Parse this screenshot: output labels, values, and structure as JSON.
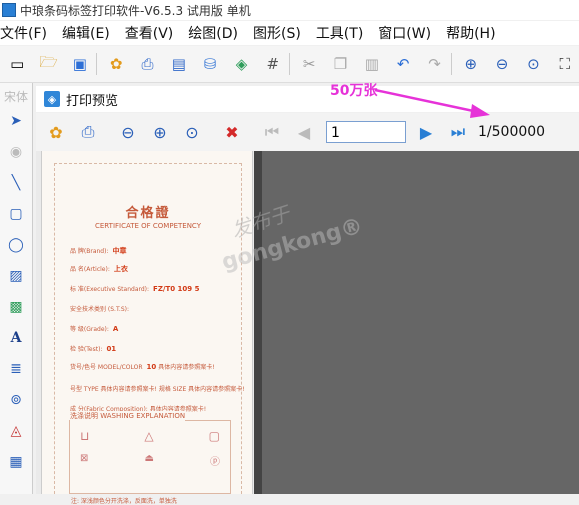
{
  "window": {
    "title": "中琅条码标签打印软件-V6.5.3 试用版 单机"
  },
  "menu": [
    "文件(F)",
    "编辑(E)",
    "查看(V)",
    "绘图(D)",
    "图形(S)",
    "工具(T)",
    "窗口(W)",
    "帮助(H)"
  ],
  "left_panel": {
    "font_label": "宋体"
  },
  "preview": {
    "title": "打印预览",
    "page_value": "1",
    "page_total": "1/500000"
  },
  "annotation": {
    "text": "50万张"
  },
  "label": {
    "title": "合格證",
    "subtitle": "CERTIFICATE OF COMPETENCY",
    "rows": [
      {
        "key": "品 牌(Brand):",
        "value": "中章"
      },
      {
        "key": "品 名(Article):",
        "value": "上衣"
      },
      {
        "key": "标 准(Executive Standard):",
        "value": "FZ/T0 109 5"
      },
      {
        "key": "安全技术类别 (S.T.S):",
        "value": ""
      },
      {
        "key": "等 级(Grade):",
        "value": "A"
      },
      {
        "key": "检 验(Test):",
        "value": "01"
      },
      {
        "key": "货号/色号 MODEL/COLOR",
        "value": "10",
        "extra": "具体内容请参照案卡!"
      },
      {
        "key": "号型 TYPE 具体内容请参照案卡!",
        "value": "",
        "extra": "规格 SIZE 具体内容请参照案卡!"
      },
      {
        "key": "成 分(Fabric Composition):",
        "value": "",
        "extra": "具体内容请参照案卡!"
      }
    ],
    "wash_title": "洗涤说明 WASHING EXPLANATION",
    "wash_note": "注: 深浅颜色分开洗涤，反面洗，单独洗"
  },
  "watermark": {
    "line1": "发布于",
    "line2": "gongkong®"
  }
}
